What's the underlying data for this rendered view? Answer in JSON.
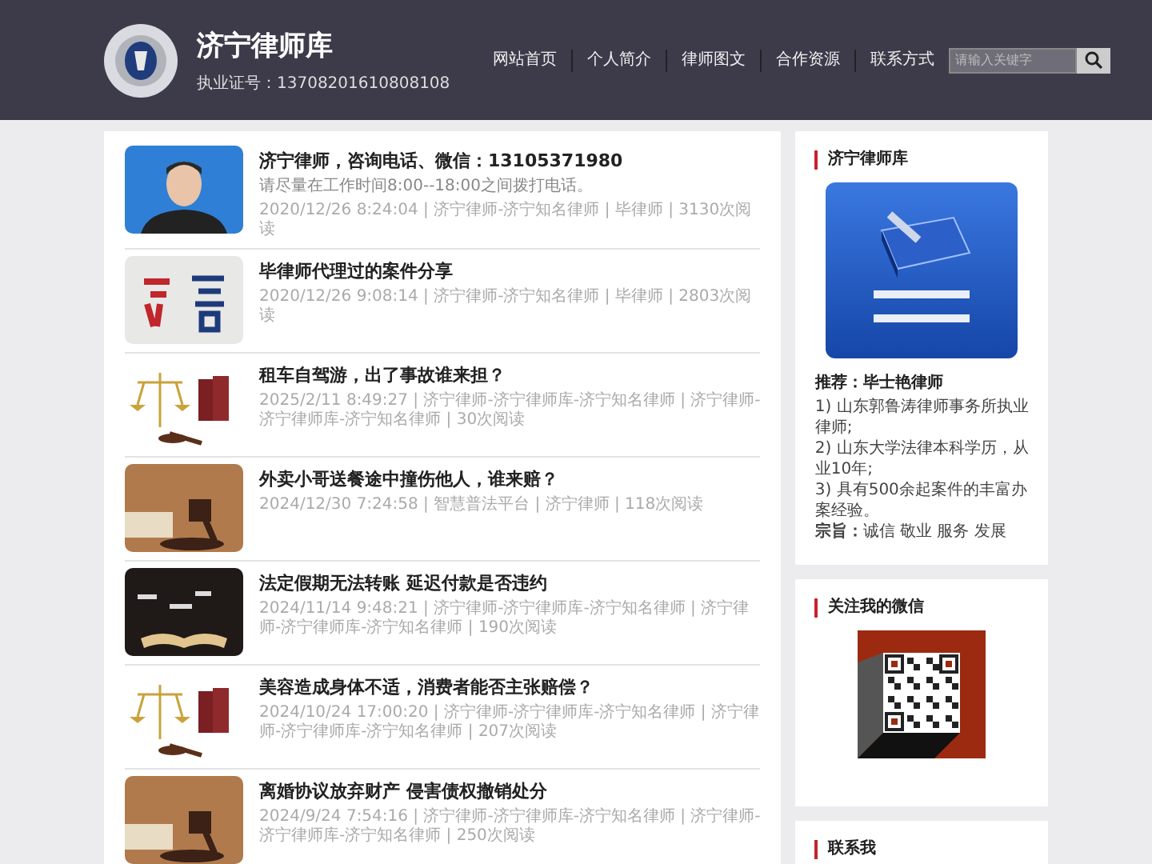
{
  "header": {
    "title": "济宁律师库",
    "license": "执业证号：13708201610808108",
    "nav": [
      "网站首页",
      "个人简介",
      "律师图文",
      "合作资源",
      "联系方式"
    ],
    "search": {
      "placeholder": "请输入关键字"
    }
  },
  "articles": [
    {
      "title": "济宁律师，咨询电话、微信：13105371980",
      "description": "请尽量在工作时间8:00--18:00之间拨打电话。",
      "meta": "2020/12/26 8:24:04 | 济宁律师-济宁知名律师 | 毕律师 | 3130次阅读",
      "kind": "portrait"
    },
    {
      "title": "毕律师代理过的案件分享",
      "meta": "2020/12/26 9:08:14 | 济宁律师-济宁知名律师 | 毕律师 | 2803次阅读",
      "kind": "calligraphy"
    },
    {
      "title": "租车自驾游，出了事故谁来担？",
      "meta": "2025/2/11 8:49:27 | 济宁律师-济宁律师库-济宁知名律师 | 济宁律师-济宁律师库-济宁知名律师 | 30次阅读",
      "kind": "scales"
    },
    {
      "title": "外卖小哥送餐途中撞伤他人，谁来赔？",
      "meta": "2024/12/30 7:24:58 | 智慧普法平台 | 济宁律师 | 118次阅读",
      "kind": "gavel"
    },
    {
      "title": "法定假期无法转账 延迟付款是否违约",
      "meta": "2024/11/14 9:48:21 | 济宁律师-济宁律师库-济宁知名律师 | 济宁律师-济宁律师库-济宁知名律师 | 190次阅读",
      "kind": "book"
    },
    {
      "title": "美容造成身体不适，消费者能否主张赔偿？",
      "meta": "2024/10/24 17:00:20 | 济宁律师-济宁律师库-济宁知名律师 | 济宁律师-济宁律师库-济宁知名律师 | 207次阅读",
      "kind": "scales"
    },
    {
      "title": "离婚协议放弃财产 侵害债权撤销处分",
      "meta": "2024/9/24 7:54:16 | 济宁律师-济宁律师库-济宁知名律师 | 济宁律师-济宁律师库-济宁知名律师 | 250次阅读",
      "kind": "gavel"
    }
  ],
  "sidebar": [
    {
      "kind": "profile",
      "heading": "济宁律师库",
      "recommend": "推荐：毕士艳律师",
      "lines": [
        "1) 山东郭鲁涛律师事务所执业律师;",
        "2) 山东大学法律本科学历，从业10年;",
        "3) 具有500余起案件的丰富办案经验。"
      ],
      "motto": "**宗旨：**诚信 敬业 服务 发展"
    },
    {
      "kind": "qr",
      "heading": "关注我的微信"
    },
    {
      "kind": "contact",
      "heading": "联系我"
    }
  ]
}
